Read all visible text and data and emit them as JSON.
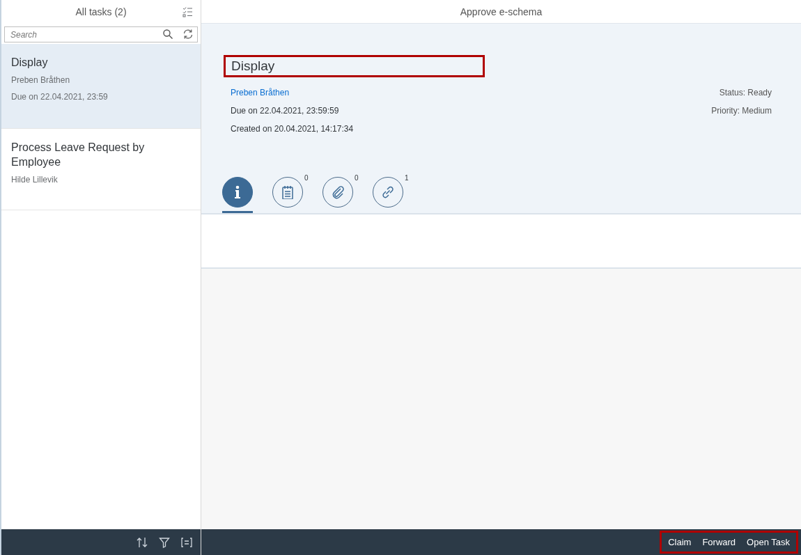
{
  "master": {
    "title": "All tasks (2)",
    "search": {
      "placeholder": "Search"
    },
    "items": [
      {
        "title": "Display",
        "lines": [
          "Preben Bråthen",
          "Due on 22.04.2021, 23:59"
        ],
        "selected": true
      },
      {
        "title": "Process Leave Request by Employee",
        "lines": [
          "Hilde Lillevik"
        ],
        "selected": false
      }
    ]
  },
  "detail": {
    "title": "Approve e-schema",
    "header": {
      "title": "Display",
      "highlighted": true,
      "creator": "Preben Bråthen",
      "due": "Due on 22.04.2021, 23:59:59",
      "created": "Created on 20.04.2021, 14:17:34",
      "status": "Status: Ready",
      "priority": "Priority: Medium"
    },
    "tabs": [
      {
        "kind": "info",
        "selected": true
      },
      {
        "kind": "notes",
        "count": "0",
        "selected": false
      },
      {
        "kind": "attachments",
        "count": "0",
        "selected": false
      },
      {
        "kind": "links",
        "count": "1",
        "selected": false
      }
    ]
  },
  "footer": {
    "actions_highlighted": true,
    "actions": [
      "Claim",
      "Forward",
      "Open Task"
    ]
  }
}
